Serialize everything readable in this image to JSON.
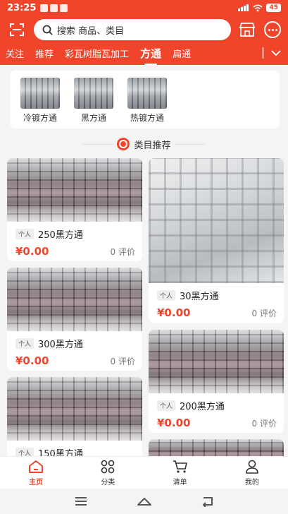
{
  "status_bar": {
    "time": "23:25",
    "battery": "45"
  },
  "search": {
    "placeholder": "搜索 商品、类目"
  },
  "tabs": [
    {
      "label": "关注"
    },
    {
      "label": "推荐"
    },
    {
      "label": "彩瓦树脂瓦加工"
    },
    {
      "label": "方通",
      "active": true
    },
    {
      "label": "扁通"
    }
  ],
  "categories": [
    {
      "label": "冷镀方通"
    },
    {
      "label": "黑方通"
    },
    {
      "label": "热镀方通"
    }
  ],
  "section": {
    "title": "类目推荐"
  },
  "products": [
    {
      "tag": "个人",
      "title": "250黑方通",
      "price": "¥0.00",
      "reviews": "0 评价"
    },
    {
      "tag": "个人",
      "title": "30黑方通",
      "price": "¥0.00",
      "reviews": "0 评价"
    },
    {
      "tag": "个人",
      "title": "300黑方通",
      "price": "¥0.00",
      "reviews": "0 评价"
    },
    {
      "tag": "个人",
      "title": "200黑方通",
      "price": "¥0.00",
      "reviews": "0 评价"
    },
    {
      "tag": "个人",
      "title": "150黑方通"
    }
  ],
  "bottom_nav": [
    {
      "label": "主页",
      "icon": "home-icon",
      "active": true
    },
    {
      "label": "分类",
      "icon": "category-icon"
    },
    {
      "label": "清单",
      "icon": "cart-icon"
    },
    {
      "label": "我的",
      "icon": "user-icon"
    }
  ],
  "colors": {
    "brand": "#f0442b",
    "background": "#f4f4f4"
  }
}
